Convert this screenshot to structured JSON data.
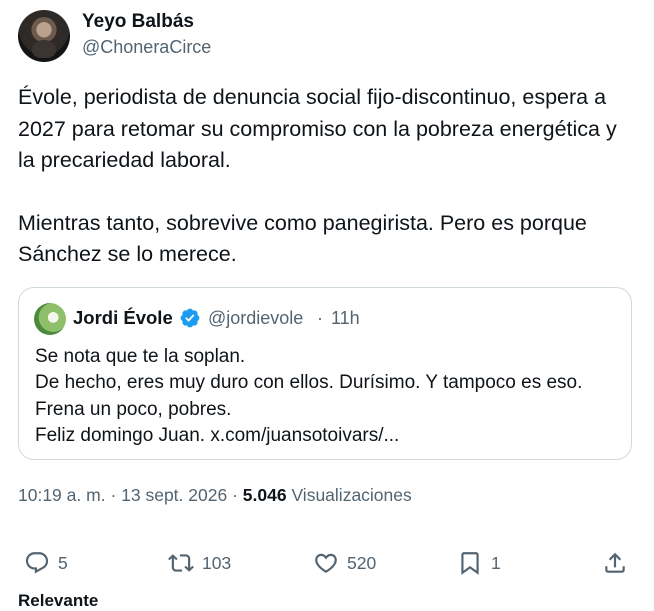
{
  "author": {
    "name": "Yeyo Balbás",
    "handle": "@ChoneraCirce"
  },
  "tweet": {
    "paragraphs": [
      "Évole, periodista de denuncia social fijo-discontinuo, espera a 2027 para retomar su compromiso con la pobreza energética y la precariedad laboral.",
      "Mientras tanto, sobrevive como panegirista. Pero es porque Sánchez se lo merece."
    ]
  },
  "quote": {
    "name": "Jordi Évole",
    "handle": "@jordievole",
    "separator": "·",
    "time": "11h",
    "lines": [
      "Se nota que te la soplan.",
      "De hecho, eres muy duro con ellos. Durísimo. Y tampoco es eso.",
      "Frena un poco, pobres.",
      "Feliz domingo Juan. x.com/juansotoivars/..."
    ]
  },
  "meta": {
    "time": "10:19 a. m.",
    "sep1": "·",
    "date": "13 sept. 2026",
    "sep2": "·",
    "views": "5.046",
    "views_label": "Visualizaciones"
  },
  "actions": {
    "replies": "5",
    "retweets": "103",
    "likes": "520",
    "bookmarks": "1"
  },
  "relevant_label": "Relevante",
  "colors": {
    "text": "#0f1419",
    "secondary": "#536471",
    "border": "#cfd9de",
    "verified": "#1d9bf0"
  }
}
